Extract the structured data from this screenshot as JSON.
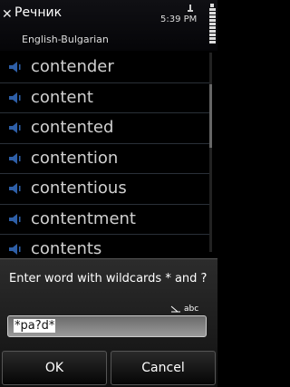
{
  "titlebar": {
    "title": "Речник",
    "close_glyph": "✕",
    "time": "5:39 PM",
    "subtitle": "English-Bulgarian"
  },
  "words": [
    {
      "label": "contender"
    },
    {
      "label": "content"
    },
    {
      "label": "contented"
    },
    {
      "label": "contention"
    },
    {
      "label": "contentious"
    },
    {
      "label": "contentment"
    },
    {
      "label": "contents"
    }
  ],
  "dialog": {
    "prompt": "Enter word with wildcards * and ?",
    "input_mode": "abc",
    "input_value": "*pa?d*",
    "ok_label": "OK",
    "cancel_label": "Cancel"
  },
  "colors": {
    "speaker_icon": "#2e5fa8",
    "word_text": "#d0d0d0"
  }
}
